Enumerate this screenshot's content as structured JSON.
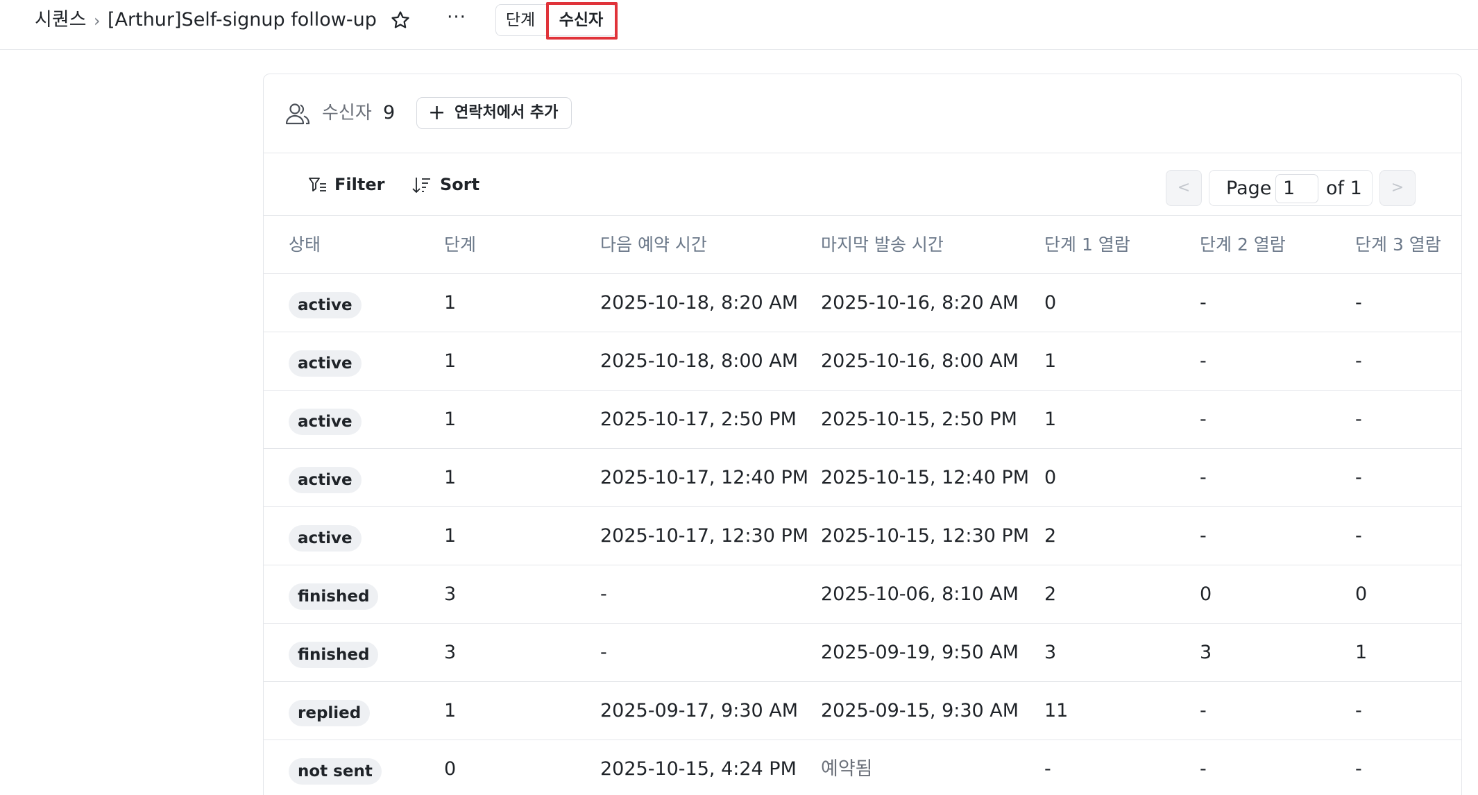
{
  "header": {
    "breadcrumb_root": "시퀀스",
    "breadcrumb_sep": "›",
    "title": "[Arthur]Self-signup follow-up",
    "more_label": "···",
    "tabs": [
      {
        "label": "단계",
        "active": false
      },
      {
        "label": "수신자",
        "active": true
      }
    ],
    "highlight_color": "#e0333a"
  },
  "card": {
    "recipients_label": "수신자",
    "recipients_count": "9",
    "add_button_label": "연락처에서 추가",
    "add_button_icon": "plus-icon",
    "recipients_icon": "people-icon"
  },
  "toolbar": {
    "filter_label": "Filter",
    "sort_label": "Sort",
    "pagination": {
      "prev_label": "<",
      "page_label": "Page",
      "page_value": "1",
      "of_label": "of 1",
      "next_label": ">"
    }
  },
  "table": {
    "columns": [
      "상태",
      "단계",
      "다음 예약 시간",
      "마지막 발송 시간",
      "단계 1 열람",
      "단계 2 열람",
      "단계 3 열람"
    ],
    "rows": [
      {
        "status": "active",
        "step": "1",
        "next": "2025-10-18, 8:20 AM",
        "last": "2025-10-16, 8:20 AM",
        "s1": "0",
        "s2": "-",
        "s3": "-"
      },
      {
        "status": "active",
        "step": "1",
        "next": "2025-10-18, 8:00 AM",
        "last": "2025-10-16, 8:00 AM",
        "s1": "1",
        "s2": "-",
        "s3": "-"
      },
      {
        "status": "active",
        "step": "1",
        "next": "2025-10-17, 2:50 PM",
        "last": "2025-10-15, 2:50 PM",
        "s1": "1",
        "s2": "-",
        "s3": "-"
      },
      {
        "status": "active",
        "step": "1",
        "next": "2025-10-17, 12:40 PM",
        "last": "2025-10-15, 12:40 PM",
        "s1": "0",
        "s2": "-",
        "s3": "-"
      },
      {
        "status": "active",
        "step": "1",
        "next": "2025-10-17, 12:30 PM",
        "last": "2025-10-15, 12:30 PM",
        "s1": "2",
        "s2": "-",
        "s3": "-"
      },
      {
        "status": "finished",
        "step": "3",
        "next": "-",
        "last": "2025-10-06, 8:10 AM",
        "s1": "2",
        "s2": "0",
        "s3": "0"
      },
      {
        "status": "finished",
        "step": "3",
        "next": "-",
        "last": "2025-09-19, 9:50 AM",
        "s1": "3",
        "s2": "3",
        "s3": "1"
      },
      {
        "status": "replied",
        "step": "1",
        "next": "2025-09-17, 9:30 AM",
        "last": "2025-09-15, 9:30 AM",
        "s1": "11",
        "s2": "-",
        "s3": "-"
      },
      {
        "status": "not sent",
        "step": "0",
        "next": "2025-10-15, 4:24 PM",
        "last": "예약됨",
        "s1": "-",
        "s2": "-",
        "s3": "-"
      }
    ]
  }
}
